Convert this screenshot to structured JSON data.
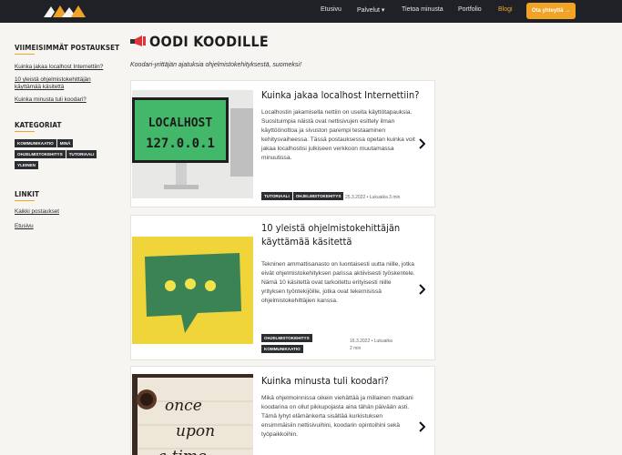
{
  "header": {
    "nav": [
      "Etusivu",
      "Palvelut ▾",
      "Tietoa minusta",
      "Portfolio",
      "Blogi"
    ],
    "cta": "Ota yhteyttä →",
    "colors": {
      "bar": "#1f2126",
      "accent": "#f0a324"
    }
  },
  "sidebar": {
    "recent_heading": "VIIMEISIMMÄT POSTAUKSET",
    "recent": [
      "Kuinka jakaa localhost Internettiin?",
      "10 yleistä ohjelmistokehittäjän käyttämää käsitettä",
      "Kuinka minusta tuli koodari?"
    ],
    "categories_heading": "KATEGORIAT",
    "categories": [
      "KOMMUNIKAATIO",
      "MINÄ",
      "OHJELMISTOKEHITYS",
      "TUTORIAALI",
      "YLEINEN"
    ],
    "links_heading": "LINKIT",
    "links": [
      "Kaikki postaukset",
      "Etusivu"
    ]
  },
  "main": {
    "title": "OODI KOODILLE",
    "tagline": "Koodari-yrittäjän ajatuksia ohjelmistokehityksestä, suomeksi!"
  },
  "posts": [
    {
      "title": "Kuinka jakaa localhost Internettiin?",
      "text": "Localhostin jakamisella nettiin on useita käyttötapauksia. Suosituimpia näistä ovat nettisivujen esittely ilman käyttöönottoa ja sivuston parempi testaaminen kehitysvaiheessa. Tässä postauksessa opetan kuinka voit jakaa localhostisi julkiseen verkkoon muutamassa minuutissa.",
      "tags": [
        "TUTORIAALI",
        "OHJELMISTOKEHITYS"
      ],
      "meta": "25.3.2022 • Lukuaika 3 min",
      "image_text": [
        "LOCALHOST",
        "127.0.0.1"
      ]
    },
    {
      "title": "10 yleistä ohjelmistokehittäjän käyttämää käsitettä",
      "text": "Tekninen ammattisanasto on luontaisesti uutta niille, jotka eivät ohjelmistokehityksen parissa aktiivisesti työskentele. Nämä 10 käsitettä ovat tarkoitettu erityisesti niille yrityksen työntekijöille, jotka ovat tekemisissä ohjelmistokehittäjien kanssa.",
      "tags": [
        "OHJELMISTOKEHITYS",
        "KOMMUNIKAATIO"
      ],
      "meta": "16.3.2022 • Lukuaika 2 min"
    },
    {
      "title": "Kuinka minusta tuli koodari?",
      "text": "Mikä ohjelmoinnissa oikein viehättää ja millainen matkani koodarina on ollut pikkupojasta aina tähän päivään asti. Tämä lyhyt elämänkerta sisältää kurkistuksen ensimmäisiin nettisivuihini, koodarin opintoihini sekä työpaikkoihin.",
      "image_text": [
        "once",
        "upon",
        "a time"
      ]
    }
  ]
}
